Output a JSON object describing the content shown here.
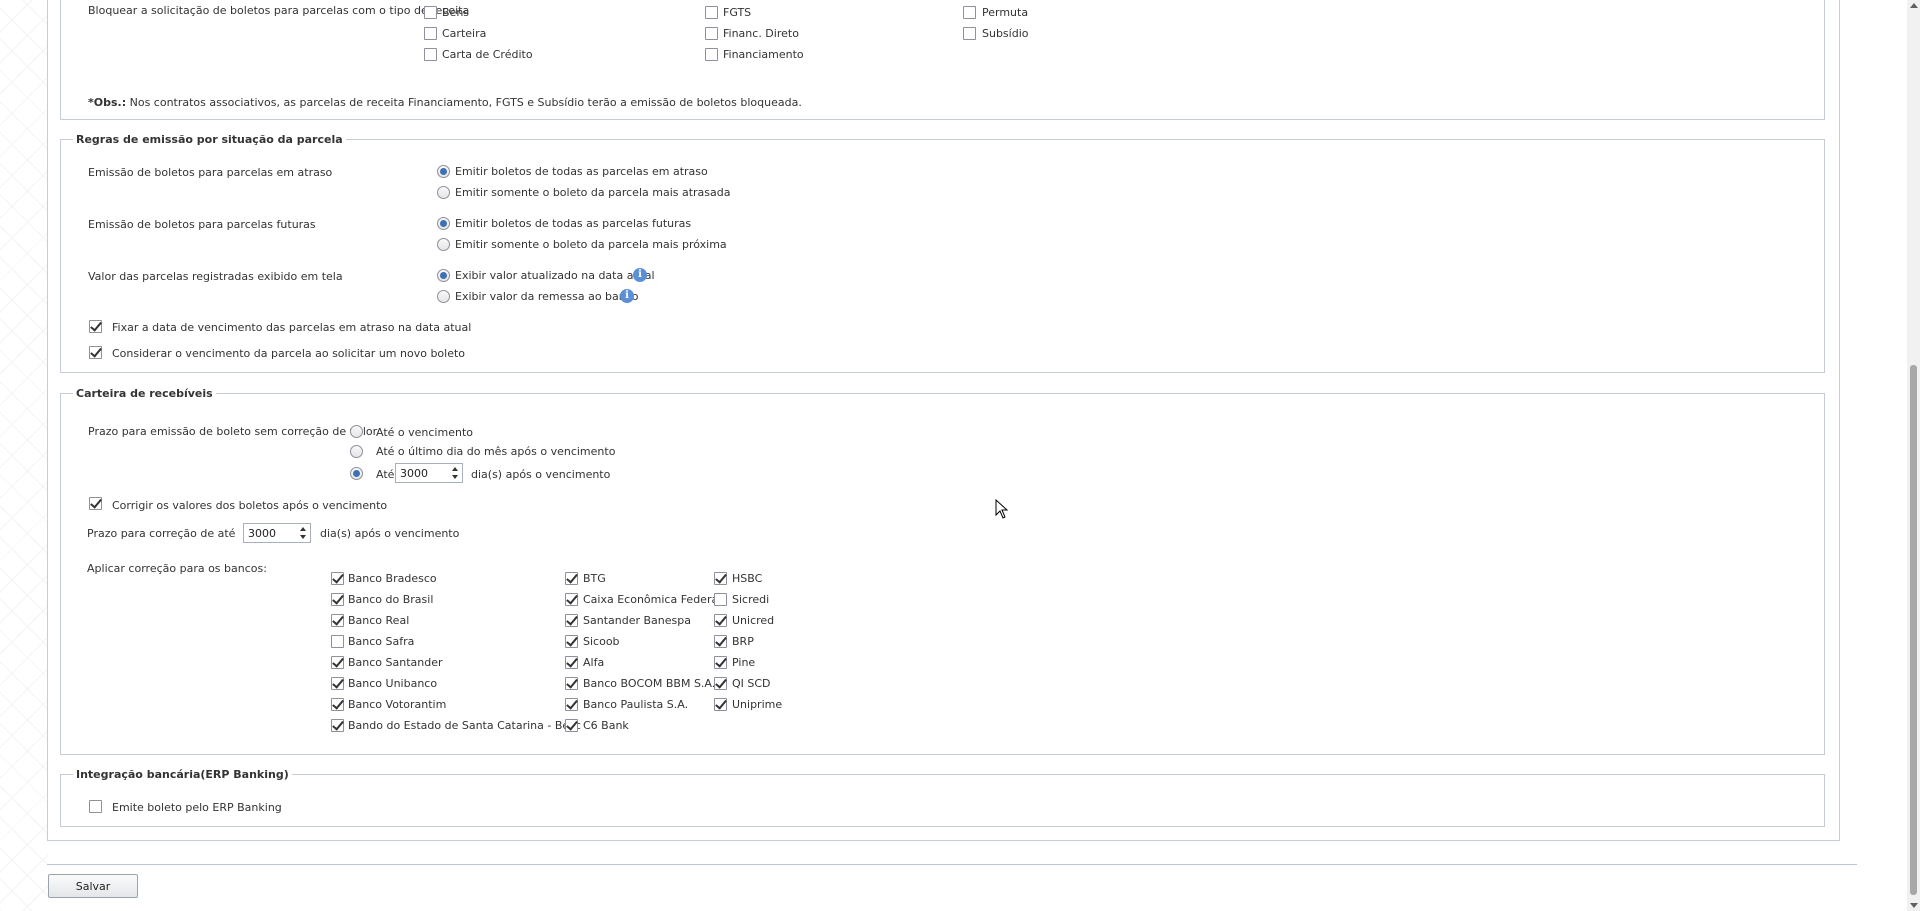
{
  "tipo_receita": {
    "label": "Bloquear a solicitação de boletos para parcelas com o tipo de receita",
    "options": [
      {
        "label": "Bens",
        "checked": false
      },
      {
        "label": "Carteira",
        "checked": false
      },
      {
        "label": "Carta de Crédito",
        "checked": false
      },
      {
        "label": "FGTS",
        "checked": false
      },
      {
        "label": "Financ. Direto",
        "checked": false
      },
      {
        "label": "Financiamento",
        "checked": false
      },
      {
        "label": "Permuta",
        "checked": false
      },
      {
        "label": "Subsídio",
        "checked": false
      }
    ],
    "obs_prefix": "*Obs.:",
    "obs_text": " Nos contratos associativos, as parcelas de receita Financiamento, FGTS e Subsídio terão a emissão de boletos bloqueada."
  },
  "regras": {
    "legend": "Regras de emissão por situação da parcela",
    "atraso_label": "Emissão de boletos para parcelas em atraso",
    "atraso_opt1": "Emitir boletos de todas as parcelas em atraso",
    "atraso_opt2": "Emitir somente o boleto da parcela mais atrasada",
    "futuras_label": "Emissão de boletos para parcelas futuras",
    "futuras_opt1": "Emitir boletos de todas as parcelas futuras",
    "futuras_opt2": "Emitir somente o boleto da parcela mais próxima",
    "valor_label": "Valor das parcelas registradas exibido em tela",
    "valor_opt1": "Exibir valor atualizado na data atual",
    "valor_opt2": "Exibir valor da remessa ao banco",
    "fixar_label": "Fixar a data de vencimento das parcelas em atraso na data atual",
    "considerar_label": "Considerar o vencimento da parcela ao solicitar um novo boleto"
  },
  "carteira": {
    "legend": "Carteira de recebíveis",
    "prazo_label": "Prazo para emissão de boleto sem correção de valor",
    "prazo_opt1": "Até o vencimento",
    "prazo_opt2": "Até o último dia do mês após o vencimento",
    "prazo_opt3_prefix": "Até",
    "prazo_opt3_value": "3000",
    "prazo_opt3_suffix": "dia(s) após o vencimento",
    "corrigir_label": "Corrigir os valores dos boletos após o vencimento",
    "prazo_correcao_label": "Prazo para correção de até",
    "prazo_correcao_value": "3000",
    "prazo_correcao_suffix": "dia(s) após o vencimento",
    "aplicar_label": "Aplicar correção para os bancos:",
    "bancos": [
      {
        "label": "Banco Bradesco",
        "checked": true
      },
      {
        "label": "Banco do Brasil",
        "checked": true
      },
      {
        "label": "Banco Real",
        "checked": true
      },
      {
        "label": "Banco Safra",
        "checked": false
      },
      {
        "label": "Banco Santander",
        "checked": true
      },
      {
        "label": "Banco Unibanco",
        "checked": true
      },
      {
        "label": "Banco Votorantim",
        "checked": true
      },
      {
        "label": "Bando do Estado de Santa Catarina - Besc",
        "checked": true
      },
      {
        "label": "BTG",
        "checked": true
      },
      {
        "label": "Caixa Econômica Federal",
        "checked": true
      },
      {
        "label": "Santander Banespa",
        "checked": true
      },
      {
        "label": "Sicoob",
        "checked": true
      },
      {
        "label": "Alfa",
        "checked": true
      },
      {
        "label": "Banco BOCOM BBM S.A.",
        "checked": true
      },
      {
        "label": "Banco Paulista S.A.",
        "checked": true
      },
      {
        "label": "C6 Bank",
        "checked": true
      },
      {
        "label": "HSBC",
        "checked": true
      },
      {
        "label": "Sicredi",
        "checked": false
      },
      {
        "label": "Unicred",
        "checked": true
      },
      {
        "label": "BRP",
        "checked": true
      },
      {
        "label": "Pine",
        "checked": true
      },
      {
        "label": "QI SCD",
        "checked": true
      },
      {
        "label": "Uniprime",
        "checked": true
      }
    ]
  },
  "integracao": {
    "legend": "Integração bancária(ERP Banking)",
    "emite_label": "Emite boleto pelo ERP Banking"
  },
  "footer": {
    "save_label": "Salvar"
  },
  "icons": {
    "info": "info-icon"
  },
  "colors": {
    "accent": "#3f6fb5",
    "info": "#5b8fd6"
  }
}
